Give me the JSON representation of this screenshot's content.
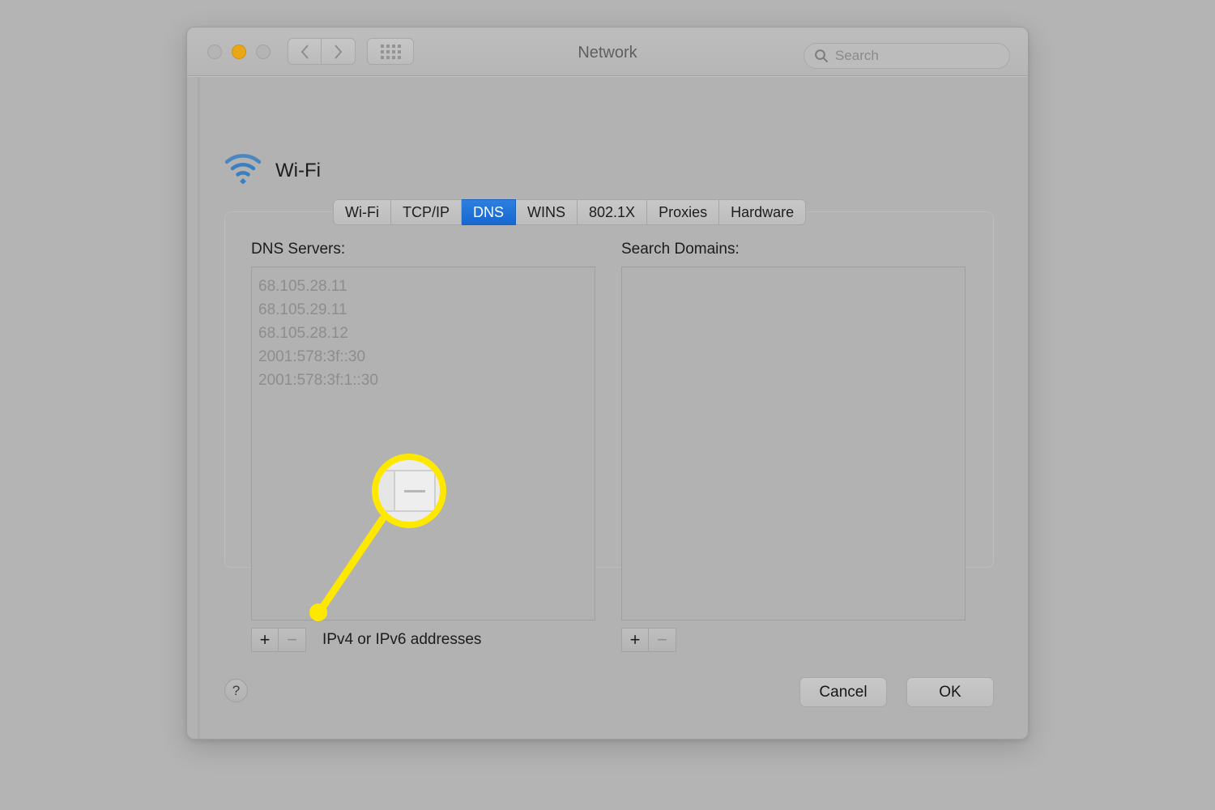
{
  "window": {
    "title": "Network",
    "traffic_lights": [
      {
        "name": "close",
        "color": "#b4b4b4",
        "state": "inactive"
      },
      {
        "name": "minimize",
        "color": "#e9a615",
        "state": "active"
      },
      {
        "name": "zoom",
        "color": "#b4b4b4",
        "state": "inactive"
      }
    ],
    "nav": {
      "back": "‹",
      "forward": "›"
    },
    "grid_button": "show-all-grid"
  },
  "search": {
    "icon": "search-icon",
    "placeholder": "Search",
    "value": ""
  },
  "service": {
    "name": "Wi-Fi",
    "icon": "wifi-icon",
    "icon_color": "#3a7fc1"
  },
  "tabs": [
    {
      "label": "Wi-Fi",
      "active": false
    },
    {
      "label": "TCP/IP",
      "active": false
    },
    {
      "label": "DNS",
      "active": true
    },
    {
      "label": "WINS",
      "active": false
    },
    {
      "label": "802.1X",
      "active": false
    },
    {
      "label": "Proxies",
      "active": false
    },
    {
      "label": "Hardware",
      "active": false
    }
  ],
  "accent_color": "#1667cf",
  "dns_servers": {
    "label": "DNS Servers:",
    "items": [
      "68.105.28.11",
      "68.105.29.11",
      "68.105.28.12",
      "2001:578:3f::30",
      "2001:578:3f:1::30"
    ],
    "add_label": "+",
    "remove_label": "−",
    "hint": "IPv4 or IPv6 addresses"
  },
  "search_domains": {
    "label": "Search Domains:",
    "items": [],
    "add_label": "+",
    "remove_label": "−"
  },
  "footer": {
    "help_label": "?",
    "cancel_label": "Cancel",
    "ok_label": "OK"
  },
  "callout": {
    "highlight_color": "#ffe800",
    "target": "remove-dns-server-button",
    "magnified_glyph": "−"
  }
}
